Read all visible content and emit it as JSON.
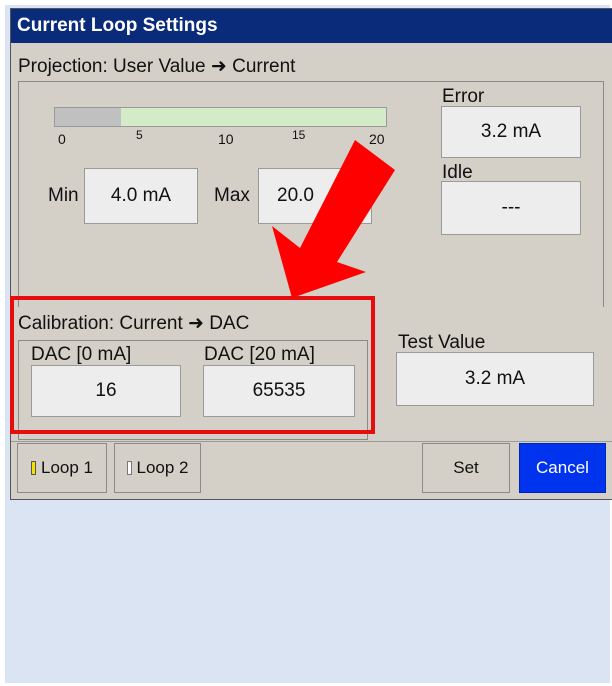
{
  "window": {
    "title": "Current Loop Settings"
  },
  "projection": {
    "label": "Projection: User Value ➜ Current",
    "bar": {
      "ticks": [
        "0",
        "5",
        "10",
        "15",
        "20"
      ],
      "range": [
        0,
        20
      ],
      "fill_value": 4.0
    },
    "min_label": "Min",
    "min_value": "4.0 mA",
    "max_label": "Max",
    "max_value": "20.0",
    "error_label": "Error",
    "error_value": "3.2 mA",
    "idle_label": "Idle",
    "idle_value": "---"
  },
  "calibration": {
    "label": "Calibration: Current ➜ DAC",
    "dac0_label": "DAC [0 mA]",
    "dac0_value": "16",
    "dac20_label": "DAC [20 mA]",
    "dac20_value": "65535"
  },
  "test": {
    "label": "Test Value",
    "value": "3.2 mA"
  },
  "buttons": {
    "loop1": "Loop 1",
    "loop2": "Loop 2",
    "set": "Set",
    "cancel": "Cancel"
  },
  "colors": {
    "titlebar": "#0a2a7a",
    "highlight": "#e50d0d",
    "arrow": "#ff0000",
    "cancel": "#0033ee",
    "bar_fill": "#c0c0c0",
    "bar_track": "#d3ebc7"
  }
}
